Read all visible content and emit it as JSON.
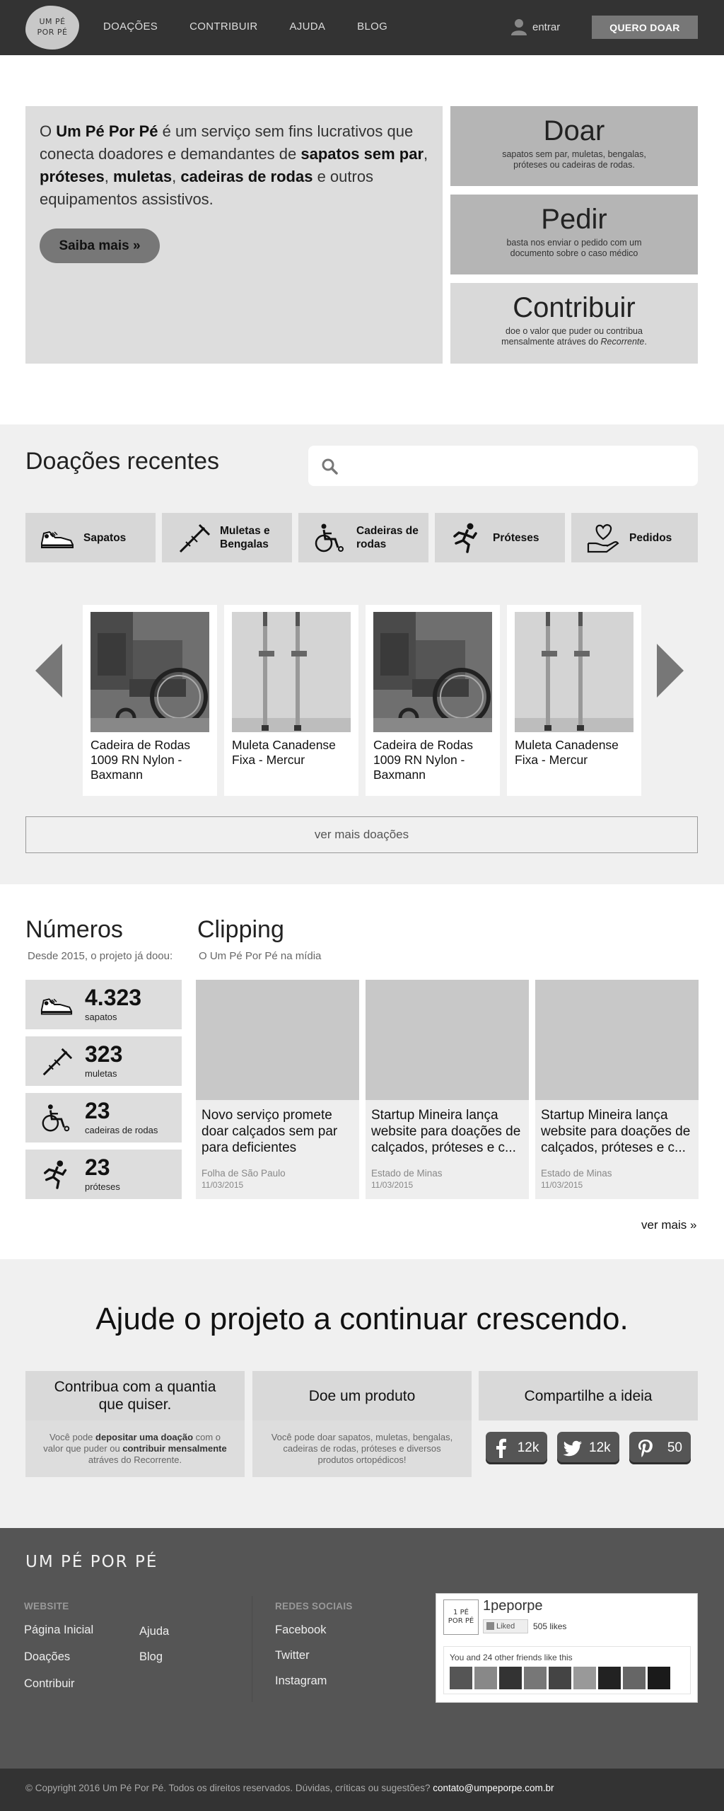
{
  "navbar": {
    "logo_line1": "UM PÉ",
    "logo_line2": "POR PÉ",
    "links": [
      "DOAÇÕES",
      "CONTRIBUIR",
      "AJUDA",
      "BLOG"
    ],
    "login": "entrar",
    "cta": "QUERO DOAR"
  },
  "hero": {
    "t1": "O ",
    "b1": "Um Pé Por Pé",
    "t2": " é um serviço sem fins lucrativos que conecta doadores e demandantes de ",
    "b2": "sapatos sem par",
    "t3": ", ",
    "b3": "próteses",
    "t4": ", ",
    "b4": "muletas",
    "t5": ", ",
    "b5": "cadeiras de rodas",
    "t6": " e outros equipamentos assistivos.",
    "button": "Saiba mais »"
  },
  "actions": [
    {
      "title": "Doar",
      "desc": "sapatos sem par, muletas, bengalas, próteses ou cadeiras de rodas."
    },
    {
      "title": "Pedir",
      "desc": "basta nos enviar o pedido com um documento sobre o caso médico"
    },
    {
      "title": "Contribuir",
      "desc_a": "doe o valor que puder ou contribua mensalmente atráves do ",
      "desc_b": "Recorrente",
      "desc_c": "."
    }
  ],
  "recentes": {
    "title": "Doações recentes",
    "search_placeholder": "",
    "categories": [
      {
        "label": "Sapatos",
        "icon": "sneaker-icon"
      },
      {
        "label": "Muletas e Bengalas",
        "icon": "crutch-icon"
      },
      {
        "label": "Cadeiras de rodas",
        "icon": "wheelchair-icon"
      },
      {
        "label": "Próteses",
        "icon": "runner-prosthesis-icon"
      },
      {
        "label": "Pedidos",
        "icon": "heart-hand-icon"
      }
    ],
    "products": [
      {
        "name": "Cadeira de Rodas 1009 RN Nylon - Baxmann",
        "image": "wheelchair-photo"
      },
      {
        "name": "Muleta Canadense Fixa - Mercur",
        "image": "crutches-photo"
      },
      {
        "name": "Cadeira de Rodas 1009 RN Nylon - Baxmann",
        "image": "wheelchair-photo"
      },
      {
        "name": "Muleta Canadense Fixa - Mercur",
        "image": "crutches-photo"
      }
    ],
    "ver_mais": "ver mais doações"
  },
  "numeros": {
    "title": "Números",
    "subtitle": "Desde 2015, o projeto já doou:",
    "stats": [
      {
        "value": "4.323",
        "label": "sapatos",
        "icon": "sneaker-icon"
      },
      {
        "value": "323",
        "label": "muletas",
        "icon": "crutch-icon"
      },
      {
        "value": "23",
        "label": "cadeiras de rodas",
        "icon": "wheelchair-icon"
      },
      {
        "value": "23",
        "label": "próteses",
        "icon": "runner-prosthesis-icon"
      }
    ]
  },
  "clipping": {
    "title": "Clipping",
    "subtitle": "O Um Pé Por Pé na mídia",
    "items": [
      {
        "title": "Novo serviço promete doar calçados sem par para deficientes",
        "source": "Folha de São Paulo",
        "date": "11/03/2015"
      },
      {
        "title": "Startup Mineira lança website para doações de calçados, próteses e c...",
        "source": "Estado de Minas",
        "date": "11/03/2015"
      },
      {
        "title": "Startup Mineira lança website para doações de calçados, próteses e c...",
        "source": "Estado de Minas",
        "date": "11/03/2015"
      }
    ],
    "ver_mais": "ver mais »"
  },
  "ajude": {
    "title": "Ajude o projeto a continuar crescendo.",
    "card1": {
      "title": "Contribua com a quantia que quiser.",
      "t1": "Você pode ",
      "b1": "depositar uma doação",
      "t2": " com o valor que puder ou ",
      "b2": "contribuir mensalmente",
      "t3": " atráves do Recorrente."
    },
    "card2": {
      "title": "Doe um produto",
      "body": "Você pode doar sapatos, muletas, bengalas, cadeiras de rodas, próteses e diversos produtos ortopédicos!"
    },
    "card3": {
      "title": "Compartilhe a ideia",
      "shares": [
        {
          "network": "facebook",
          "icon": "facebook-icon",
          "count": "12k"
        },
        {
          "network": "twitter",
          "icon": "twitter-icon",
          "count": "12k"
        },
        {
          "network": "pinterest",
          "icon": "pinterest-icon",
          "count": "50"
        }
      ]
    }
  },
  "footer": {
    "logo": "UM PÉ POR PÉ",
    "website_head": "WEBSITE",
    "website_links": [
      "Página Inicial",
      "Doações",
      "Contribuir",
      "Ajuda",
      "Blog"
    ],
    "social_head": "REDES SOCIAIS",
    "social_links": [
      "Facebook",
      "Twitter",
      "Instagram"
    ],
    "fb": {
      "thumb_line1": "1 PÉ",
      "thumb_line2": "POR PÉ",
      "page": "1peporpe",
      "liked": "Liked",
      "likes": "505 likes",
      "friends": "You and 24 other friends like this"
    },
    "copyright": "© Copyright 2016 Um Pé Por Pé. Todos os direitos reservados. Dúvidas, críticas ou sugestões? ",
    "email": "contato@umpeporpe.com.br"
  },
  "colors": {
    "navbar_bg": "#333333",
    "card_gray": "#dddddd",
    "action_dark": "#b5b5b5",
    "section_bg": "#f0f0f0",
    "footer_bg": "#555555"
  }
}
